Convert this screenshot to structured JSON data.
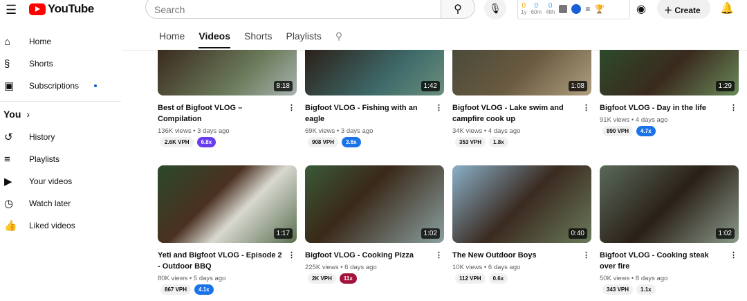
{
  "header": {
    "logo": "YouTube",
    "search_placeholder": "Search",
    "create_label": "Create",
    "ext": {
      "stats": [
        {
          "value": "0",
          "label": "1y",
          "color": "#f2a900"
        },
        {
          "value": "0",
          "label": "60m",
          "color": "#3ea6ff"
        },
        {
          "value": "0",
          "label": "48h",
          "color": "#3ea6ff"
        }
      ]
    }
  },
  "sidebar": {
    "items": [
      {
        "label": "Home",
        "icon": "⌂"
      },
      {
        "label": "Shorts",
        "icon": "§"
      },
      {
        "label": "Subscriptions",
        "icon": "▣"
      }
    ],
    "you_label": "You",
    "you_items": [
      {
        "label": "History",
        "icon": "↺"
      },
      {
        "label": "Playlists",
        "icon": "≡"
      },
      {
        "label": "Your videos",
        "icon": "▶"
      },
      {
        "label": "Watch later",
        "icon": "◷"
      },
      {
        "label": "Liked videos",
        "icon": "👍"
      }
    ]
  },
  "tabs": [
    "Home",
    "Videos",
    "Shorts",
    "Playlists"
  ],
  "videos": [
    {
      "title": "Best of Bigfoot VLOG – Compilation",
      "views": "136K views • 3 days ago",
      "vph": "2.6K VPH",
      "mult": "6.8x",
      "mult_color": "#6a3cf0",
      "duration": "8:18"
    },
    {
      "title": "Bigfoot VLOG - Fishing with an eagle",
      "views": "69K views • 3 days ago",
      "vph": "908 VPH",
      "mult": "3.6x",
      "mult_color": "#1a73e8",
      "duration": "1:42"
    },
    {
      "title": "Bigfoot VLOG - Lake swim and campfire cook up",
      "views": "34K views • 4 days ago",
      "vph": "353 VPH",
      "mult": "1.8x",
      "mult_color": "",
      "duration": "1:08"
    },
    {
      "title": "Bigfoot VLOG - Day in the life",
      "views": "91K views • 4 days ago",
      "vph": "890 VPH",
      "mult": "4.7x",
      "mult_color": "#1a73e8",
      "duration": "1:29"
    },
    {
      "title": "Yeti and Bigfoot VLOG - Episode 2 - Outdoor BBQ",
      "views": "80K views • 5 days ago",
      "vph": "867 VPH",
      "mult": "4.1x",
      "mult_color": "#1a73e8",
      "duration": "1:17"
    },
    {
      "title": "Bigfoot VLOG - Cooking Pizza",
      "views": "225K views • 6 days ago",
      "vph": "2K VPH",
      "mult": "11x",
      "mult_color": "#a3123a",
      "duration": "1:02"
    },
    {
      "title": "The New Outdoor Boys",
      "views": "10K views • 6 days ago",
      "vph": "112 VPH",
      "mult": "0.6x",
      "mult_color": "",
      "duration": "0:40"
    },
    {
      "title": "Bigfoot VLOG - Cooking steak over fire",
      "views": "50K views • 8 days ago",
      "vph": "343 VPH",
      "mult": "1.1x",
      "mult_color": "",
      "duration": "1:02"
    }
  ]
}
